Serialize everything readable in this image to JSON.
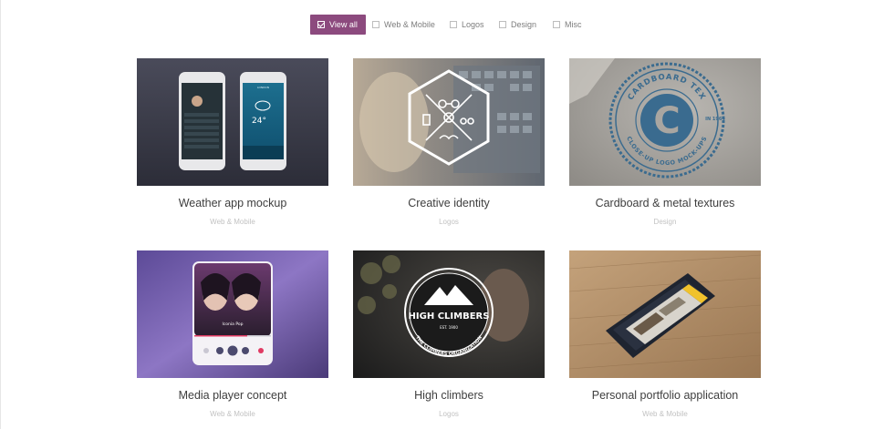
{
  "filters": [
    {
      "label": "View all",
      "active": true
    },
    {
      "label": "Web & Mobile",
      "active": false
    },
    {
      "label": "Logos",
      "active": false
    },
    {
      "label": "Design",
      "active": false
    },
    {
      "label": "Misc",
      "active": false
    }
  ],
  "portfolio": [
    {
      "title": "Weather app mockup",
      "category": "Web & Mobile"
    },
    {
      "title": "Creative identity",
      "category": "Logos"
    },
    {
      "title": "Cardboard & metal textures",
      "category": "Design"
    },
    {
      "title": "Media player concept",
      "category": "Web & Mobile"
    },
    {
      "title": "High climbers",
      "category": "Logos"
    },
    {
      "title": "Personal portfolio application",
      "category": "Web & Mobile"
    }
  ],
  "thumb_text": {
    "weather_city": "LONDON",
    "weather_temp": "24°",
    "cardboard_top": "CARDBOARD TEX",
    "cardboard_bottom": "CLOSE-UP LOGO MOCK-UPS",
    "cardboard_letter": "C",
    "cardboard_badge": "IN 1964",
    "climbers_name": "HIGH CLIMBERS",
    "climbers_est": "EST. 1900",
    "climbers_org": "THE CLIMBERS ORGANIZATION",
    "media_track": "Iconia Pop"
  },
  "colors": {
    "accent": "#8c4a7e"
  }
}
